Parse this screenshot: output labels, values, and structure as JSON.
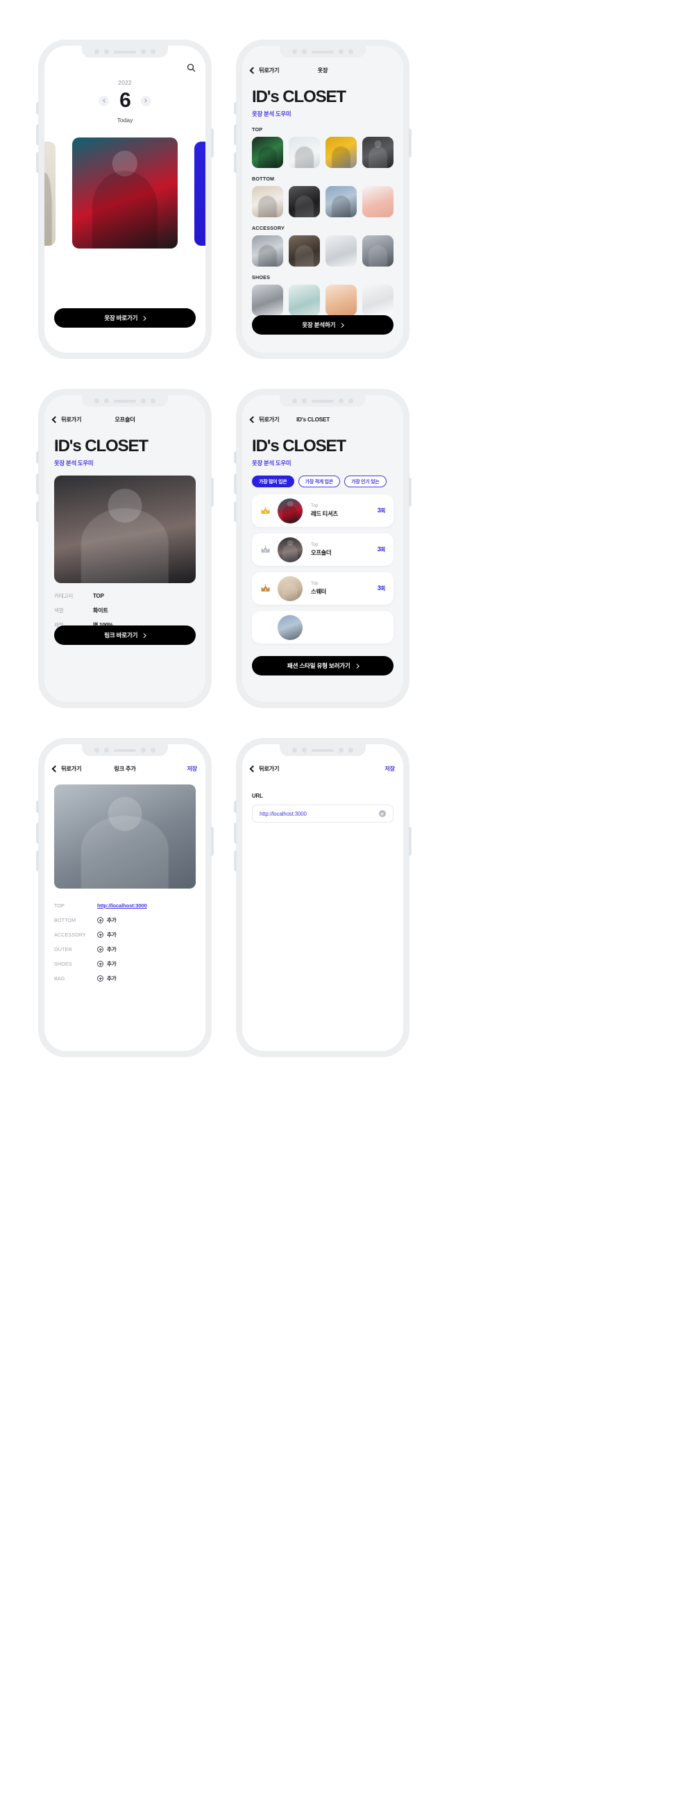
{
  "app": {
    "brand_title": "ID's CLOSET",
    "brand_subtitle": "옷장 분석 도우미",
    "accent_color": "#4338e8",
    "accent_strong": "#2a20e0"
  },
  "phone1": {
    "search_icon": "search-icon",
    "year": "2022",
    "day": "6",
    "today_label": "Today",
    "prev_icon": "chevron-left-icon",
    "next_icon": "chevron-right-icon",
    "cta_label": "옷장 바로가기"
  },
  "phone2": {
    "nav": {
      "back_label": "뒤로가기",
      "title": "옷장"
    },
    "sections": [
      {
        "label": "TOP",
        "items": [
          "green-top",
          "white-knit",
          "yellow-blouse",
          "off-shoulder"
        ]
      },
      {
        "label": "BOTTOM",
        "items": [
          "beige-pants",
          "black-leather-pants",
          "blue-jeans",
          "pink-jogger"
        ]
      },
      {
        "label": "ACCESSORY",
        "items": [
          "sunglasses",
          "brown-bag",
          "white-sunglasses",
          "gray-scarf"
        ]
      },
      {
        "label": "SHOES",
        "items": [
          "silver-heels",
          "white-sneakers",
          "nude-sandals",
          "white-mules"
        ]
      }
    ],
    "cta_label": "옷장 분석하기"
  },
  "phone3": {
    "nav": {
      "back_label": "뒤로가기",
      "title": "오프숄더"
    },
    "photo": "off-shoulder-portrait",
    "specs": [
      {
        "key": "카테고리",
        "value": "TOP"
      },
      {
        "key": "색깔",
        "value": "화이트"
      },
      {
        "key": "재질",
        "value": "면 100%"
      }
    ],
    "cta_label": "링크 바로가기"
  },
  "phone4": {
    "nav": {
      "back_label": "뒤로가기",
      "title": "ID's CLOSET"
    },
    "filters": [
      {
        "label": "가장 많이 입은",
        "active": true
      },
      {
        "label": "가장 적게 입은",
        "active": false
      },
      {
        "label": "가장 인기 있는",
        "active": false
      }
    ],
    "ranking": [
      {
        "rank": "1",
        "crown": "gold-crown-icon",
        "kind": "Top",
        "name": "레드 티셔츠",
        "count": "3",
        "unit": "회",
        "photo": "red-tshirt"
      },
      {
        "rank": "2",
        "crown": "silver-crown-icon",
        "kind": "Top",
        "name": "오프숄더",
        "count": "3",
        "unit": "회",
        "photo": "off-shoulder"
      },
      {
        "rank": "3",
        "crown": "bronze-crown-icon",
        "kind": "Top",
        "name": "스웨터",
        "count": "3",
        "unit": "회",
        "photo": "sweater"
      }
    ],
    "cta_label": "패션 스타일 유형 보러가기"
  },
  "phone5": {
    "nav": {
      "back_label": "뒤로가기",
      "title": "링크 추가",
      "action_label": "저장"
    },
    "photo": "gray-shirt-model",
    "rows": [
      {
        "key": "TOP",
        "url": "http://localhost:3000",
        "add_label": null
      },
      {
        "key": "BOTTOM",
        "url": null,
        "add_label": "추가"
      },
      {
        "key": "ACCESSORY",
        "url": null,
        "add_label": "추가"
      },
      {
        "key": "OUTER",
        "url": null,
        "add_label": "추가"
      },
      {
        "key": "SHOES",
        "url": null,
        "add_label": "추가"
      },
      {
        "key": "BAG",
        "url": null,
        "add_label": "추가"
      }
    ]
  },
  "phone6": {
    "nav": {
      "back_label": "뒤로가기",
      "action_label": "저장"
    },
    "field_label": "URL",
    "field_value": "http://localhost:3000",
    "field_placeholder": "http://localhost:3000",
    "clear_icon": "clear-circle-icon"
  }
}
